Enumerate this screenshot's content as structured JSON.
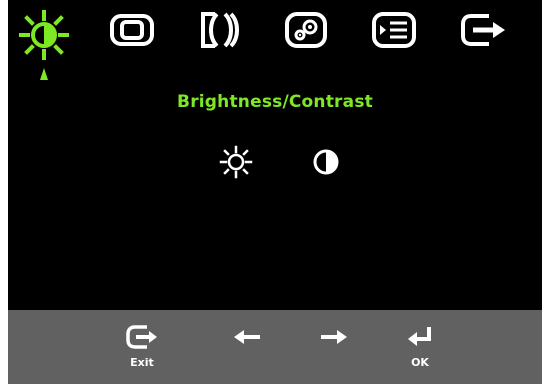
{
  "menu": {
    "tabs": [
      {
        "icon": "brightness-sun-icon",
        "active": true
      },
      {
        "icon": "image-position-icon",
        "active": false
      },
      {
        "icon": "image-setup-icon",
        "active": false
      },
      {
        "icon": "image-properties-gear-icon",
        "active": false
      },
      {
        "icon": "options-list-icon",
        "active": false
      },
      {
        "icon": "exit-icon",
        "active": false
      }
    ],
    "section_title": "Brightness/Contrast",
    "options": [
      {
        "icon": "brightness-sun-icon"
      },
      {
        "icon": "contrast-half-circle-icon"
      }
    ]
  },
  "footer": {
    "exit_label": "Exit",
    "left_icon": "arrow-left-icon",
    "right_icon": "arrow-right-icon",
    "ok_label": "OK"
  },
  "colors": {
    "background": "#000000",
    "accent": "#7ee825",
    "icon": "#ffffff",
    "footer": "#616161"
  }
}
